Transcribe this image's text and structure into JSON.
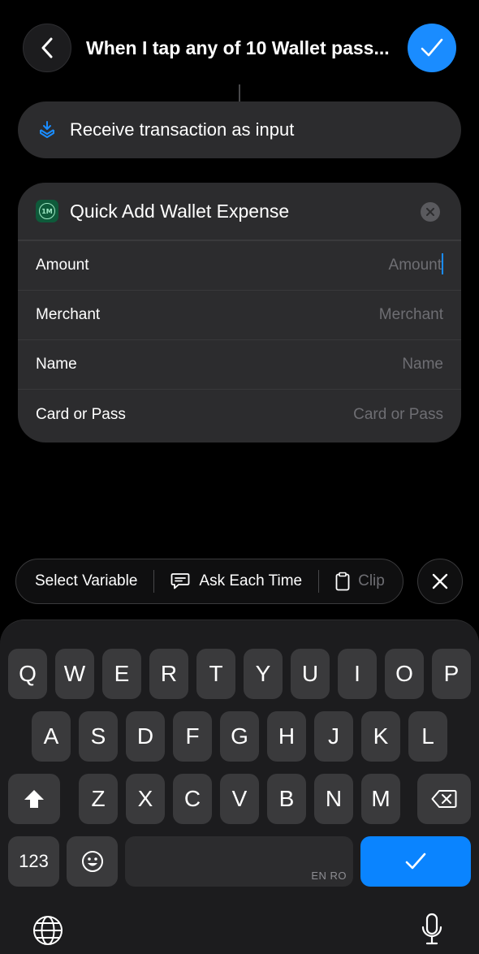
{
  "header": {
    "title": "When I tap any of 10 Wallet pass..."
  },
  "trigger": {
    "label": "Receive transaction as input"
  },
  "action": {
    "app_icon_text": "1M",
    "title": "Quick Add Wallet Expense",
    "params": [
      {
        "label": "Amount",
        "placeholder": "Amount"
      },
      {
        "label": "Merchant",
        "placeholder": "Merchant"
      },
      {
        "label": "Name",
        "placeholder": "Name"
      },
      {
        "label": "Card or Pass",
        "placeholder": "Card or Pass"
      }
    ]
  },
  "variable_bar": {
    "select_variable": "Select Variable",
    "ask_each_time": "Ask Each Time",
    "clipboard": "Clip"
  },
  "keyboard": {
    "row1": [
      "Q",
      "W",
      "E",
      "R",
      "T",
      "Y",
      "U",
      "I",
      "O",
      "P"
    ],
    "row2": [
      "A",
      "S",
      "D",
      "F",
      "G",
      "H",
      "J",
      "K",
      "L"
    ],
    "row3": [
      "Z",
      "X",
      "C",
      "V",
      "B",
      "N",
      "M"
    ],
    "numbers_key": "123",
    "space_lang": "EN RO"
  },
  "colors": {
    "accent": "#1a8cff",
    "card_bg": "#2c2c2e",
    "background": "#000000"
  }
}
